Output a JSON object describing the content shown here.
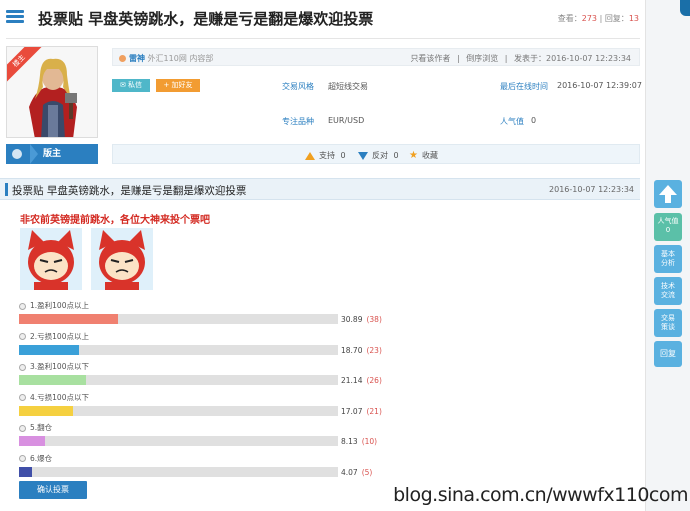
{
  "header": {
    "title": "投票贴 早盘英镑跳水，是赚是亏是翻是爆欢迎投票",
    "views_label": "查看：",
    "views": "273",
    "sep": "|",
    "replies_label": "回复：",
    "replies": "13"
  },
  "author": {
    "badge": "楼主",
    "name": "雷神",
    "meta": "外汇110网 内容部",
    "role_label": "版主",
    "msg_button": "私信",
    "friend_button": "加好友"
  },
  "info_right": {
    "only_author": "只看该作者",
    "reverse": "倒序浏览",
    "posted": "发表于：2016-10-07 12:23:34"
  },
  "fields": {
    "style_label": "交易风格",
    "style_value": "超短线交易",
    "last_online_label": "最后在线时间",
    "last_online_value": "2016-10-07 12:39:07",
    "focus_label": "专注品种",
    "focus_value": "EUR/USD",
    "popularity_label": "人气值",
    "popularity_value": "0"
  },
  "votebar": {
    "support_label": "支持",
    "support_count": "0",
    "oppose_label": "反对",
    "oppose_count": "0",
    "favorite_label": "收藏"
  },
  "post": {
    "title": "投票贴 早盘英镑跳水，是赚是亏是翻是爆欢迎投票",
    "date": "2016-10-07 12:23:34",
    "headline": "非农前英镑提前跳水，各位大神来投个票吧"
  },
  "poll": {
    "options": [
      {
        "label": "1.盈利100点以上",
        "pct": "30.89",
        "pct_value": 30.89,
        "count": "(38)",
        "color": "#f08070"
      },
      {
        "label": "2.亏损100点以上",
        "pct": "18.70",
        "pct_value": 18.7,
        "count": "(23)",
        "color": "#3aa0d8"
      },
      {
        "label": "3.盈利100点以下",
        "pct": "21.14",
        "pct_value": 21.14,
        "count": "(26)",
        "color": "#a8e0a0"
      },
      {
        "label": "4.亏损100点以下",
        "pct": "17.07",
        "pct_value": 17.07,
        "count": "(21)",
        "color": "#f5d040"
      },
      {
        "label": "5.翻仓",
        "pct": "8.13",
        "pct_value": 8.13,
        "count": "(10)",
        "color": "#d890e0"
      },
      {
        "label": "6.爆仓",
        "pct": "4.07",
        "pct_value": 4.07,
        "count": "(5)",
        "color": "#404fa8"
      }
    ],
    "submit_label": "确认投票"
  },
  "sidebar": {
    "popularity": "人气值",
    "popularity_count": "0",
    "b1": "基本分析",
    "b2": "技术交流",
    "b3": "交易策谈",
    "b4": "回复"
  },
  "watermark": "blog.sina.com.cn/wwwfx110com",
  "colors": {
    "accent": "#2b7fc0",
    "side_button": "#5ab1e0",
    "red": "#d32a22"
  }
}
